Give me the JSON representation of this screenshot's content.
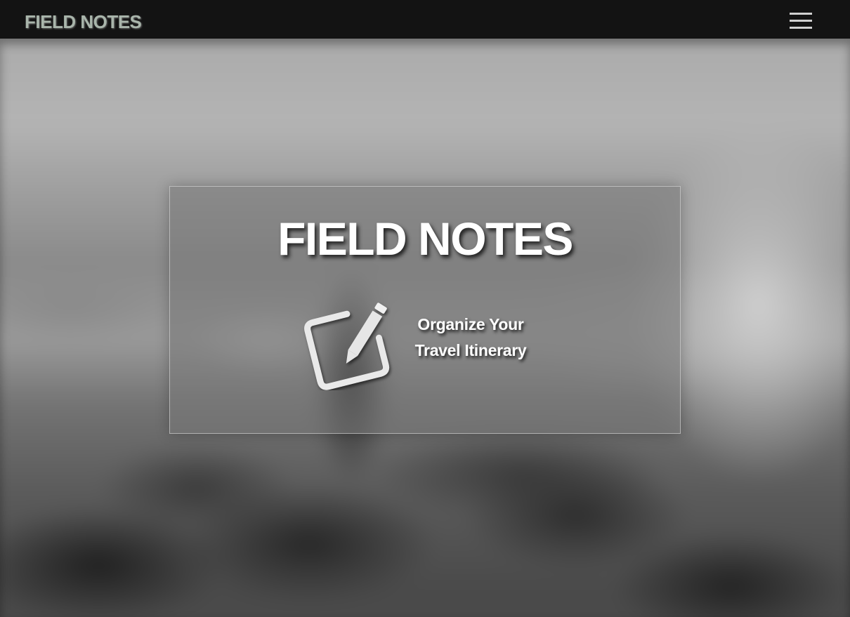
{
  "navbar": {
    "brand": "FIELD NOTES",
    "menu_icon": "hamburger-menu-icon"
  },
  "hero": {
    "title": "FIELD NOTES",
    "icon": "edit-note-icon",
    "tagline_line1": "Organize Your",
    "tagline_line2": "Travel Itinerary"
  },
  "colors": {
    "navbar_bg": "#131313",
    "brand_text": "#a9b5ab",
    "title_text": "#ffffff"
  }
}
